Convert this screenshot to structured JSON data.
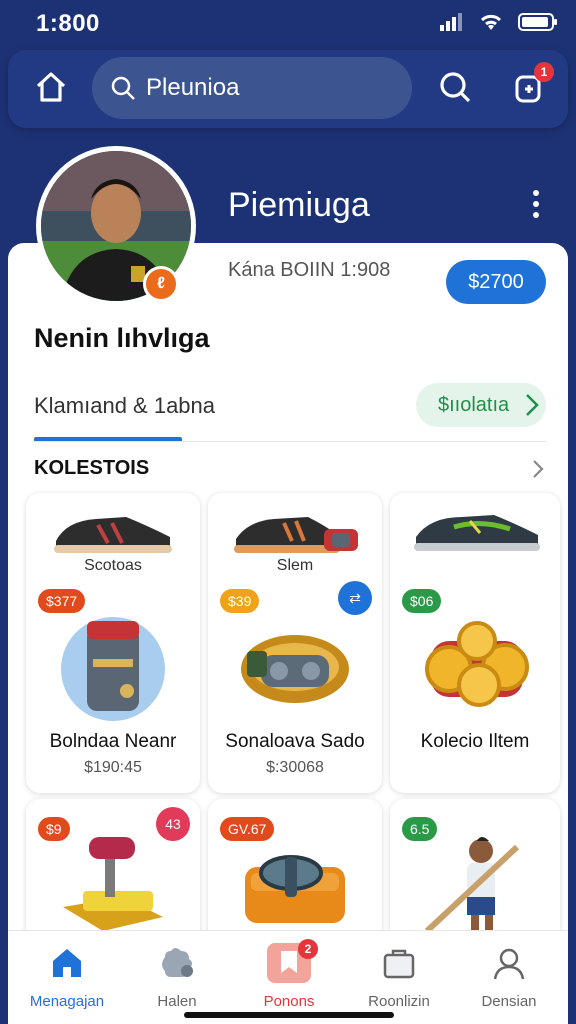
{
  "status_bar": {
    "time": "1:800"
  },
  "search": {
    "value": "Pleunioa"
  },
  "header": {
    "notification_count": "1"
  },
  "profile": {
    "display_name": "Piemiuga",
    "meta": "Kána BOIIN 1:908",
    "balance": "$2700",
    "user_name": "Nenin lıhvlıga",
    "subtitle": "Klamıand & 1abna",
    "status": "$ııolatıa"
  },
  "section": {
    "title": "KOLESTOIS"
  },
  "items": [
    {
      "shoe_name": "Scotoas",
      "tag": "$377",
      "tag_color": "#e04a1c",
      "name": "Bolndaa Neanr",
      "price": "$190:45",
      "icon": "barrel-icon"
    },
    {
      "shoe_name": "Slem",
      "tag": "$39",
      "tag_color": "#f0a21a",
      "name": "Sonaloava Sado",
      "price": "$:30068",
      "icon": "bracelet-icon",
      "corner_color": "#1e72d8"
    },
    {
      "shoe_name": "",
      "tag": "$06",
      "tag_color": "#2a9a48",
      "name": "Kolecio Iltem",
      "price": "",
      "icon": "coins-icon"
    },
    {
      "tag": "$9",
      "tag_color": "#e04a1c",
      "icon": "hammer-icon",
      "corner_text": "43",
      "corner_color": "#e23a5a"
    },
    {
      "tag": "GV.67",
      "tag_color": "#e04a1c",
      "icon": "wrench-bag-icon"
    },
    {
      "tag": "6.5",
      "tag_color": "#2a9a48",
      "icon": "player-icon"
    }
  ],
  "nav": [
    {
      "label": "Menagajan",
      "icon": "home-icon"
    },
    {
      "label": "Halen",
      "icon": "puzzle-icon"
    },
    {
      "label": "Ponons",
      "icon": "promo-icon",
      "badge": "2"
    },
    {
      "label": "Roonlizin",
      "icon": "bag-icon"
    },
    {
      "label": "Densian",
      "icon": "profile-icon"
    }
  ],
  "colors": {
    "primary": "#1e72d8",
    "header_bg": "#1d3275",
    "danger": "#e2363c"
  }
}
